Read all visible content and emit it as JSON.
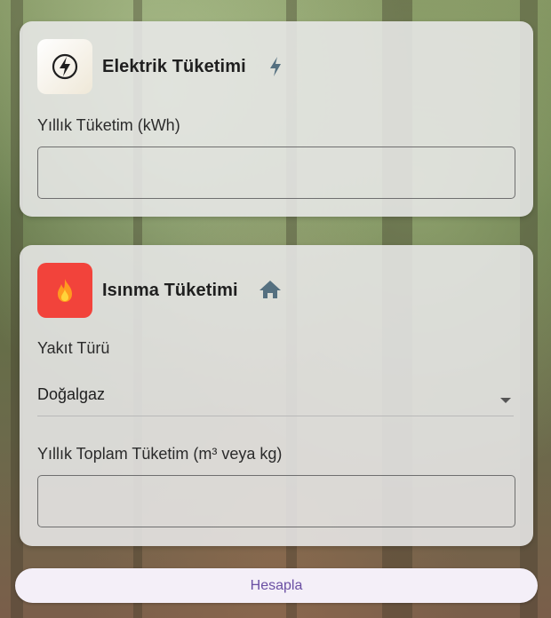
{
  "electricity": {
    "title": "Elektrik Tüketimi",
    "icon": "power-icon",
    "title_icon": "bolt-icon",
    "field_label": "Yıllık Tüketim (kWh)",
    "field_value": ""
  },
  "heating": {
    "title": "Isınma Tüketimi",
    "icon": "flame-icon",
    "title_icon": "home-icon",
    "fuel_label": "Yakıt Türü",
    "fuel_selected": "Doğalgaz",
    "consumption_label": "Yıllık Toplam Tüketim (m³ veya kg)",
    "consumption_value": ""
  },
  "actions": {
    "calculate_label": "Hesapla"
  },
  "colors": {
    "accent": "#6a4fa3",
    "heat_icon_bg": "#f2433b",
    "title_icon": "#557080"
  }
}
